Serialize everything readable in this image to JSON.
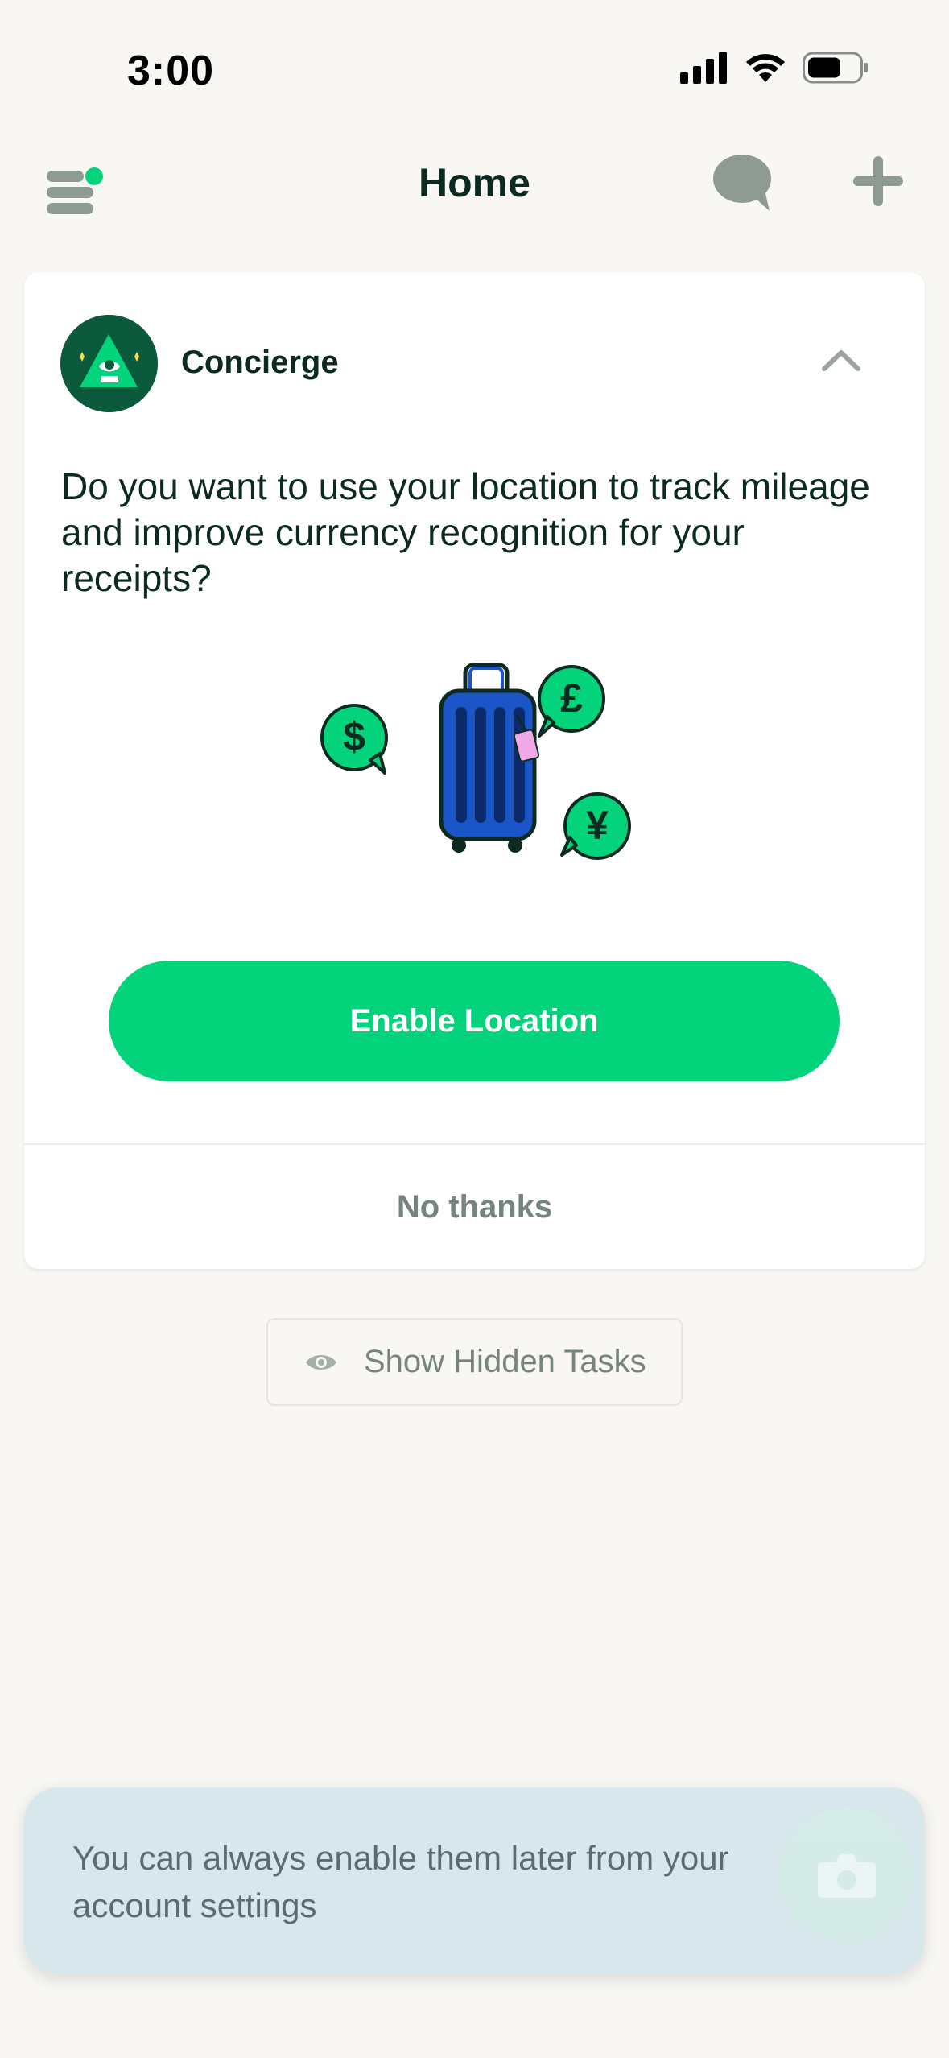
{
  "status_bar": {
    "time": "3:00",
    "icons": [
      "cellular-signal-icon",
      "wifi-icon",
      "battery-icon"
    ]
  },
  "header": {
    "title": "Home",
    "left_icon": "menu-icon",
    "right_icons": [
      "chat-icon",
      "plus-icon"
    ],
    "notification_dot": true
  },
  "card": {
    "sender": "Concierge",
    "avatar_icon": "concierge-pyramid-icon",
    "collapse_icon": "chevron-up-icon",
    "question": "Do you want to use your location to track mileage and improve currency recognition for your receipts?",
    "illustration": "suitcase-with-currency-bubbles",
    "currency_symbols": [
      "$",
      "£",
      "¥"
    ],
    "primary_button": "Enable Location",
    "secondary_button": "No thanks"
  },
  "hidden_tasks": {
    "label": "Show Hidden Tasks",
    "icon": "eye-icon"
  },
  "toast": {
    "message": "You can always enable them later from your account settings"
  },
  "fab": {
    "icon": "camera-icon"
  },
  "colors": {
    "accent": "#03d47c",
    "background": "#f8f7f4",
    "text_primary": "#0c2a22",
    "text_secondary": "#76847e",
    "toast_bg": "#d8e7ec"
  }
}
